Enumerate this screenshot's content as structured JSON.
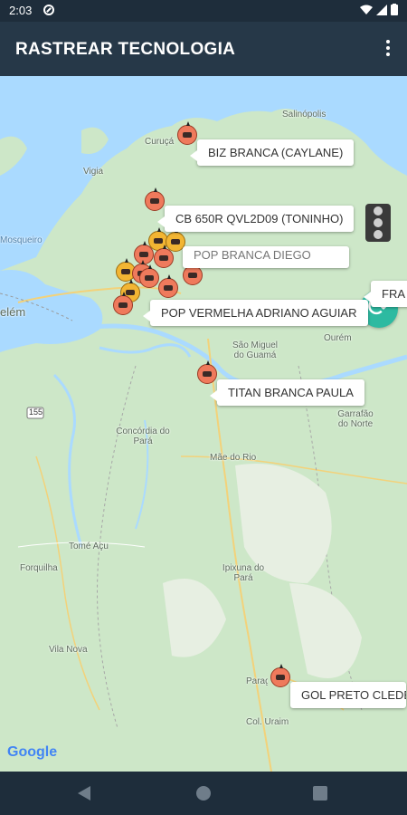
{
  "status_bar": {
    "time": "2:03"
  },
  "app_bar": {
    "title": "RASTREAR TECNOLOGIA"
  },
  "map": {
    "places": [
      {
        "name": "Salinópolis"
      },
      {
        "name": "Curuçá"
      },
      {
        "name": "Vigia"
      },
      {
        "name": "Mosqueiro"
      },
      {
        "name": "elém"
      },
      {
        "name": "São Miguel do Guamá"
      },
      {
        "name": "Ourém"
      },
      {
        "name": "Concórdia do Pará"
      },
      {
        "name": "Garrafão do Norte"
      },
      {
        "name": "Mãe do Rio"
      },
      {
        "name": "Tomé Açu"
      },
      {
        "name": "Forquilha"
      },
      {
        "name": "Ipixuna do Pará"
      },
      {
        "name": "Vila Nova"
      },
      {
        "name": "Paragominas"
      },
      {
        "name": "Col. Uraim"
      },
      {
        "name": "155"
      }
    ],
    "callouts": [
      {
        "label": "BIZ BRANCA (CAYLANE)"
      },
      {
        "label": "CB 650R QVL2D09 (TONINHO)"
      },
      {
        "label": "POP BRANCA DIEGO"
      },
      {
        "label": "FRA"
      },
      {
        "label": "POP VERMELHA ADRIANO AGUIAR"
      },
      {
        "label": "TITAN BRANCA PAULA"
      },
      {
        "label": "GOL PRETO CLEDE"
      }
    ],
    "attribution": "Google"
  },
  "colors": {
    "appbar": "#263848",
    "statusbar": "#1e2d3b",
    "refresh": "#2dbaa1",
    "marker": "#ef7a5c",
    "marker_alt": "#f2b533"
  }
}
